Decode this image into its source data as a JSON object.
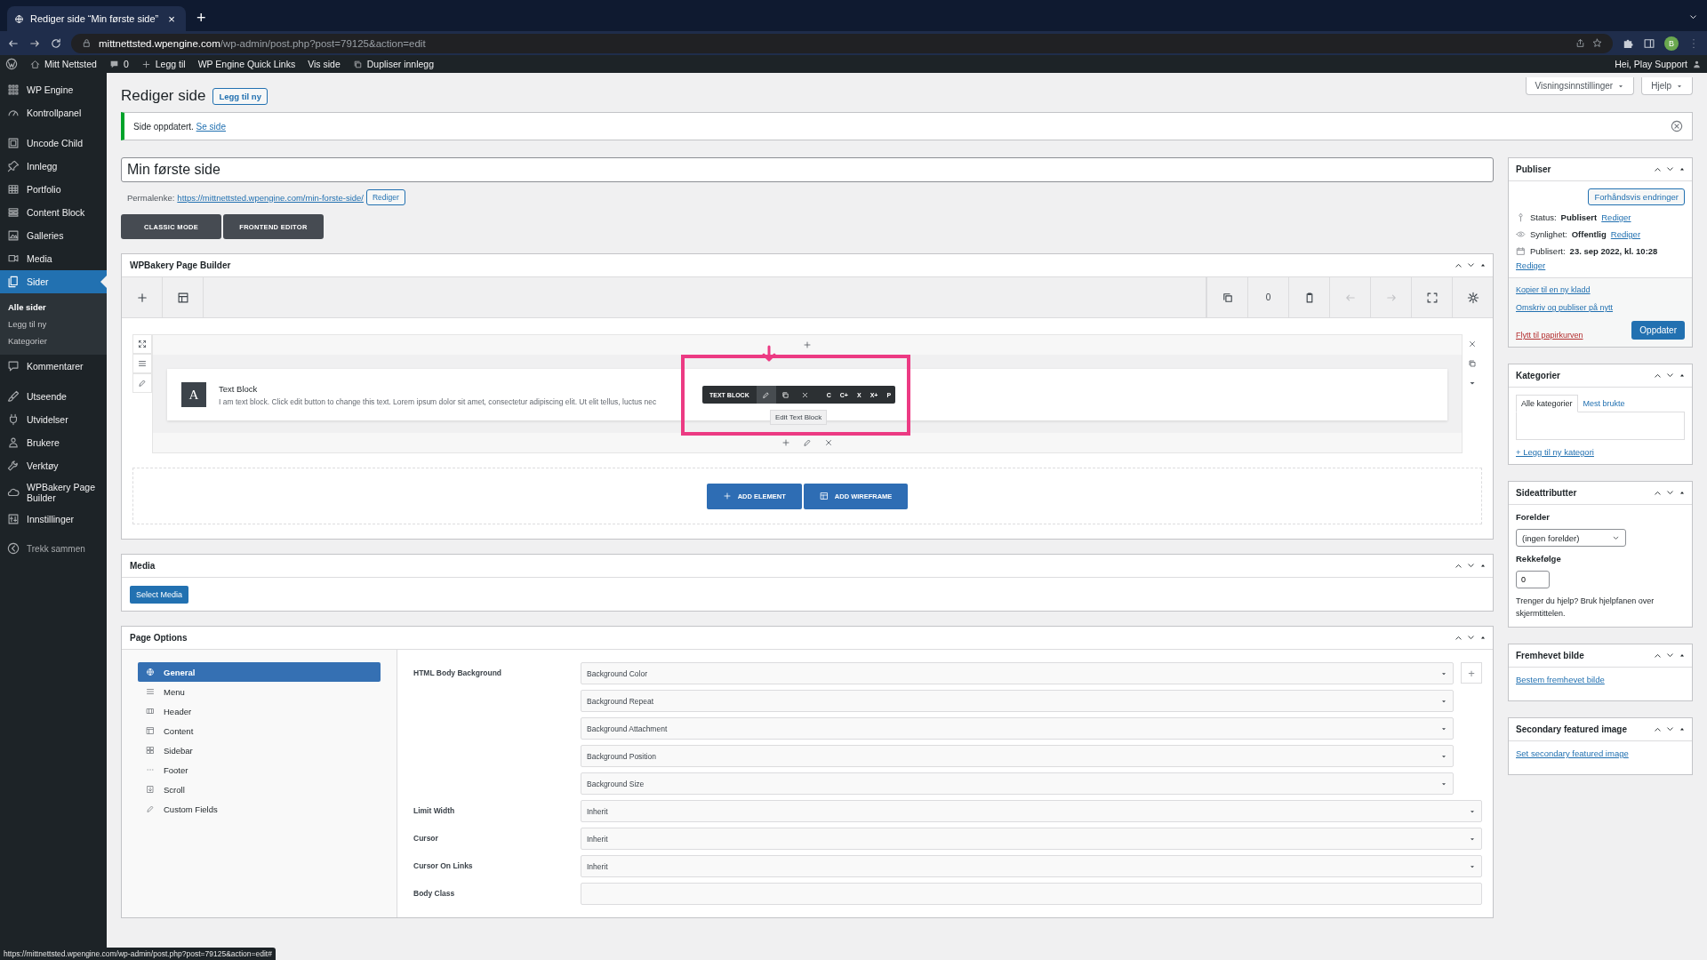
{
  "browser": {
    "tab_title": "Rediger side “Min første side”",
    "tab_close": "×",
    "new_tab": "+",
    "url_host": "mittnettsted.wpengine.com",
    "url_path": "/wp-admin/post.php?post=79125&action=edit",
    "profile_initial": "B"
  },
  "admin_bar": {
    "site": "Mitt Nettsted",
    "comments": "0",
    "new": "Legg til",
    "links": [
      "WP Engine Quick Links",
      "Vis side"
    ],
    "duplicate": "Dupliser innlegg",
    "greeting": "Hei, Play Support"
  },
  "sidebar": {
    "groups": [
      [
        {
          "label": "WP Engine",
          "selected": false
        },
        {
          "label": "Kontrollpanel",
          "selected": false
        }
      ],
      [
        {
          "label": "Uncode Child",
          "selected": false
        },
        {
          "label": "Innlegg",
          "selected": false
        },
        {
          "label": "Portfolio",
          "selected": false
        },
        {
          "label": "Content Block",
          "selected": false
        },
        {
          "label": "Galleries",
          "selected": false
        },
        {
          "label": "Media",
          "selected": false
        },
        {
          "label": "Sider",
          "selected": true,
          "children": [
            {
              "label": "Alle sider",
              "selected": true
            },
            {
              "label": "Legg til ny",
              "selected": false
            },
            {
              "label": "Kategorier",
              "selected": false
            }
          ]
        },
        {
          "label": "Kommentarer",
          "selected": false
        }
      ],
      [
        {
          "label": "Utseende",
          "selected": false
        },
        {
          "label": "Utvidelser",
          "selected": false
        },
        {
          "label": "Brukere",
          "selected": false
        },
        {
          "label": "Verktøy",
          "selected": false
        },
        {
          "label": "WPBakery Page Builder",
          "selected": false
        },
        {
          "label": "Innstillinger",
          "selected": false
        }
      ]
    ],
    "collapse": "Trekk sammen"
  },
  "header": {
    "title": "Rediger side",
    "add_new": "Legg til ny",
    "screen_buttons": [
      "Visningsinnstillinger",
      "Hjelp"
    ]
  },
  "notice": {
    "text": "Side oppdatert.",
    "link": "Se side"
  },
  "post": {
    "title": "Min første side",
    "permalink_label": "Permalenke:",
    "permalink": "https://mittnettsted.wpengine.com/min-forste-side/",
    "permalink_edit": "Rediger",
    "modes": [
      "CLASSIC MODE",
      "FRONTEND EDITOR"
    ]
  },
  "builder": {
    "title": "WPBakery Page Builder",
    "counter": "0",
    "element": {
      "icon_letter": "A",
      "title": "Text Block",
      "description": "I am text block. Click edit button to change this text. Lorem ipsum dolor sit amet, consectetur adipiscing elit. Ut elit tellus, luctus nec"
    },
    "element_toolbar": {
      "label": "TEXT BLOCK",
      "actions": [
        "C",
        "C+",
        "X",
        "X+",
        "P"
      ],
      "tooltip": "Edit Text Block"
    },
    "buttons": [
      "ADD ELEMENT",
      "ADD WIREFRAME"
    ]
  },
  "media_box": {
    "title": "Media",
    "button": "Select Media"
  },
  "page_options": {
    "title": "Page Options",
    "nav": [
      {
        "label": "General",
        "selected": true
      },
      {
        "label": "Menu",
        "selected": false
      },
      {
        "label": "Header",
        "selected": false
      },
      {
        "label": "Content",
        "selected": false
      },
      {
        "label": "Sidebar",
        "selected": false
      },
      {
        "label": "Footer",
        "selected": false
      },
      {
        "label": "Scroll",
        "selected": false
      },
      {
        "label": "Custom Fields",
        "selected": false
      }
    ],
    "fields": [
      {
        "label": "HTML Body Background",
        "add": "+",
        "controls": [
          {
            "kind": "select",
            "value": "Background Color"
          },
          {
            "kind": "select",
            "value": "Background Repeat"
          },
          {
            "kind": "select",
            "value": "Background Attachment"
          },
          {
            "kind": "select",
            "value": "Background Position"
          },
          {
            "kind": "select",
            "value": "Background Size"
          }
        ]
      },
      {
        "label": "Limit Width",
        "controls": [
          {
            "kind": "select",
            "value": "Inherit"
          }
        ]
      },
      {
        "label": "Cursor",
        "controls": [
          {
            "kind": "select",
            "value": "Inherit"
          }
        ]
      },
      {
        "label": "Cursor On Links",
        "controls": [
          {
            "kind": "select",
            "value": "Inherit"
          }
        ]
      },
      {
        "label": "Body Class",
        "controls": [
          {
            "kind": "text"
          }
        ]
      }
    ]
  },
  "publish": {
    "title": "Publiser",
    "preview": "Forhåndsvis endringer",
    "rows": [
      {
        "label": "Status:",
        "value": "Publisert",
        "link": "Rediger"
      },
      {
        "label": "Synlighet:",
        "value": "Offentlig",
        "link": "Rediger"
      },
      {
        "label": "Publisert:",
        "value": "23. sep 2022, kl. 10:28",
        "link": "Rediger"
      }
    ],
    "links": [
      "Kopier til en ny kladd",
      "Omskriv og publiser på nytt"
    ],
    "trash": "Flytt til papirkurven",
    "update": "Oppdater"
  },
  "categories": {
    "title": "Kategorier",
    "tabs": [
      {
        "label": "Alle kategorier",
        "selected": true
      },
      {
        "label": "Mest brukte",
        "selected": false
      }
    ],
    "add": "+ Legg til ny kategori"
  },
  "attributes": {
    "title": "Sideattributter",
    "parent_label": "Forelder",
    "parent": "(ingen forelder)",
    "order_label": "Rekkefølge",
    "order": "0",
    "help": "Trenger du hjelp? Bruk hjelpfanen over skjermtittelen."
  },
  "featured": {
    "title": "Fremhevet bilde",
    "link": "Bestem fremhevet bilde"
  },
  "secondary": {
    "title": "Secondary featured image",
    "link": "Set secondary featured image"
  },
  "status_url": "https://mittnettsted.wpengine.com/wp-admin/post.php?post=79125&action=edit#"
}
